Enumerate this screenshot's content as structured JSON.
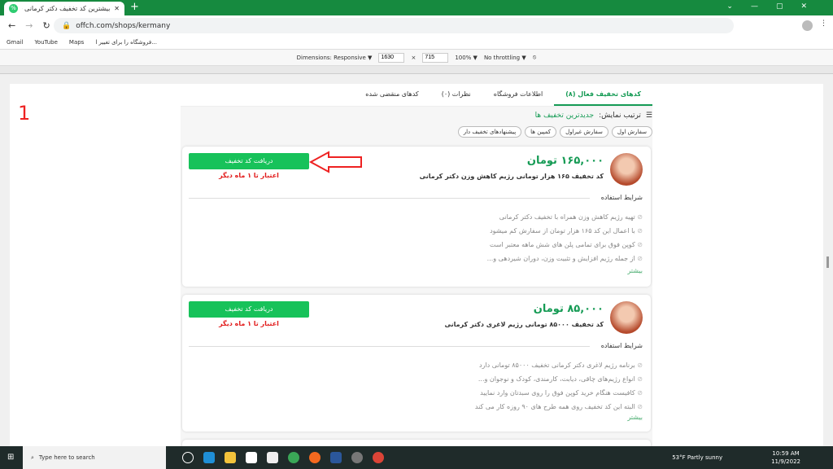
{
  "browser": {
    "tab_title": "بیشترین کد تخفیف دکتر کرمانی - many",
    "url": "offch.com/shops/kermany",
    "bookmarks": [
      "Gmail",
      "YouTube",
      "Maps",
      "فروشگاه را برای تغییر ا..."
    ]
  },
  "devtools": {
    "dimensions": "Dimensions: Responsive ▼",
    "width": "1630",
    "height": "715",
    "zoom": "100% ▼",
    "throttle": "No throttling ▼"
  },
  "annotation": "1",
  "nav_tabs": [
    "کدهای تخفیف فعال (۸)",
    "اطلاعات فروشگاه",
    "نظرات (۰)",
    "کدهای منقضی شده"
  ],
  "sort": {
    "label": "ترتیب نمایش:",
    "value": "جدیدترین تخفیف ها"
  },
  "chips": [
    "سفارش اول",
    "سفارش غیراول",
    "کمپین ها",
    "پیشنهادهای تخفیف دار"
  ],
  "cards": [
    {
      "price": "۱۶۵,۰۰۰ تومان",
      "title": "کد تخفیف ۱۶۵ هزار تومانی رژیم کاهش وزن دکتر کرمانی",
      "button": "دریافت کد تخفیف",
      "validity": "اعتبار تا ۱ ماه دیگر",
      "conditions_label": "شرایط استفاده",
      "conditions": [
        "تهیه رژیم کاهش وزن همراه با تخفیف دکتر کرمانی",
        "با اعمال این کد ۱۶۵ هزار تومان از سفارش کم میشود",
        "کوپن فوق برای تمامی پلن های شش ماهه معتبر است",
        "از جمله رژیم افزایش و تثبیت وزن، دوران شیردهی و..."
      ],
      "more": "بیشتر"
    },
    {
      "price": "۸۵,۰۰۰ تومان",
      "title": "کد تخفیف ۸۵۰۰۰ تومانی رژیم لاغری دکتر کرمانی",
      "button": "دریافت کد تخفیف",
      "validity": "اعتبار تا ۱ ماه دیگر",
      "conditions_label": "شرایط استفاده",
      "conditions": [
        "برنامه رژیم لاغری دکتر کرمانی تخفیف ۸۵۰۰۰ تومانی دارد",
        "انواع رژیم‌های چاقی، دیابت، کارمندی، کودک و نوجوان و...",
        "کافیست هنگام خرید کوپن فوق را روی سبدتان وارد نمایید",
        "البته این کد تخفیف روی همه طرح های ۹۰ روزه کار می کند"
      ],
      "more": "بیشتر"
    }
  ],
  "taskbar": {
    "search_placeholder": "Type here to search",
    "weather": "53°F  Partly sunny",
    "time": "10:59 AM",
    "date": "11/9/2022"
  },
  "colors": {
    "accent": "#169b55",
    "button": "#17c25a",
    "validity": "#e21c1c",
    "chrome": "#168a3f"
  }
}
